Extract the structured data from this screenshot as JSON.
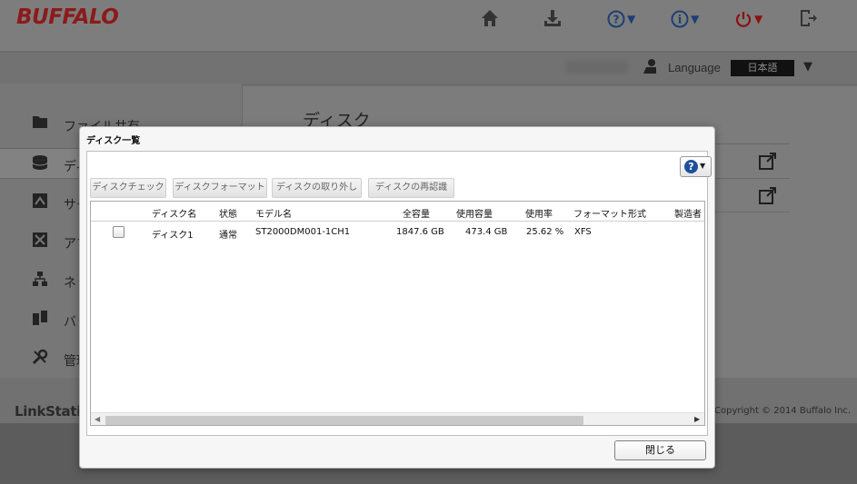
{
  "app": {
    "brand": "BUFFALO",
    "top_icons": [
      {
        "icon": "home-icon"
      },
      {
        "icon": "download-icon"
      },
      {
        "icon": "help-circle-icon",
        "has_dropdown": true
      },
      {
        "icon": "info-circle-icon",
        "has_dropdown": true
      },
      {
        "icon": "power-icon",
        "has_dropdown": true
      },
      {
        "icon": "logout-icon"
      }
    ],
    "language_label": "Language",
    "language_value": "日本語",
    "sidebar": [
      {
        "label": "ファイル共有",
        "icon": "folder-icon"
      },
      {
        "label": "ディスク",
        "icon": "disk-icon",
        "active": true
      },
      {
        "label": "サービス",
        "icon": "service-icon"
      },
      {
        "label": "アプリ",
        "icon": "app-icon"
      },
      {
        "label": "ネットワーク",
        "icon": "network-icon"
      },
      {
        "label": "バックアップ",
        "icon": "backup-icon"
      },
      {
        "label": "管理",
        "icon": "tools-icon"
      }
    ],
    "content_title": "ディスク",
    "footer_left": "LinkStation",
    "footer_right": "Copyright © 2014 Buffalo Inc."
  },
  "dialog": {
    "title": "ディスク一覧",
    "help_icon": "help-circle-icon",
    "toolbar": [
      "ディスクチェック",
      "ディスクフォーマット",
      "ディスクの取り外し",
      "ディスクの再認識"
    ],
    "columns": [
      "ディスク名",
      "状態",
      "モデル名",
      "全容量",
      "使用容量",
      "使用率",
      "フォーマット形式",
      "製造者"
    ],
    "rows": [
      {
        "checked": false,
        "disk_name": "ディスク1",
        "status": "通常",
        "model": "ST2000DM001-1CH1",
        "capacity": "1847.6 GB",
        "used": "473.4 GB",
        "usage_rate": "25.62 %",
        "format": "XFS",
        "maker": ""
      }
    ],
    "close_label": "閉じる"
  }
}
